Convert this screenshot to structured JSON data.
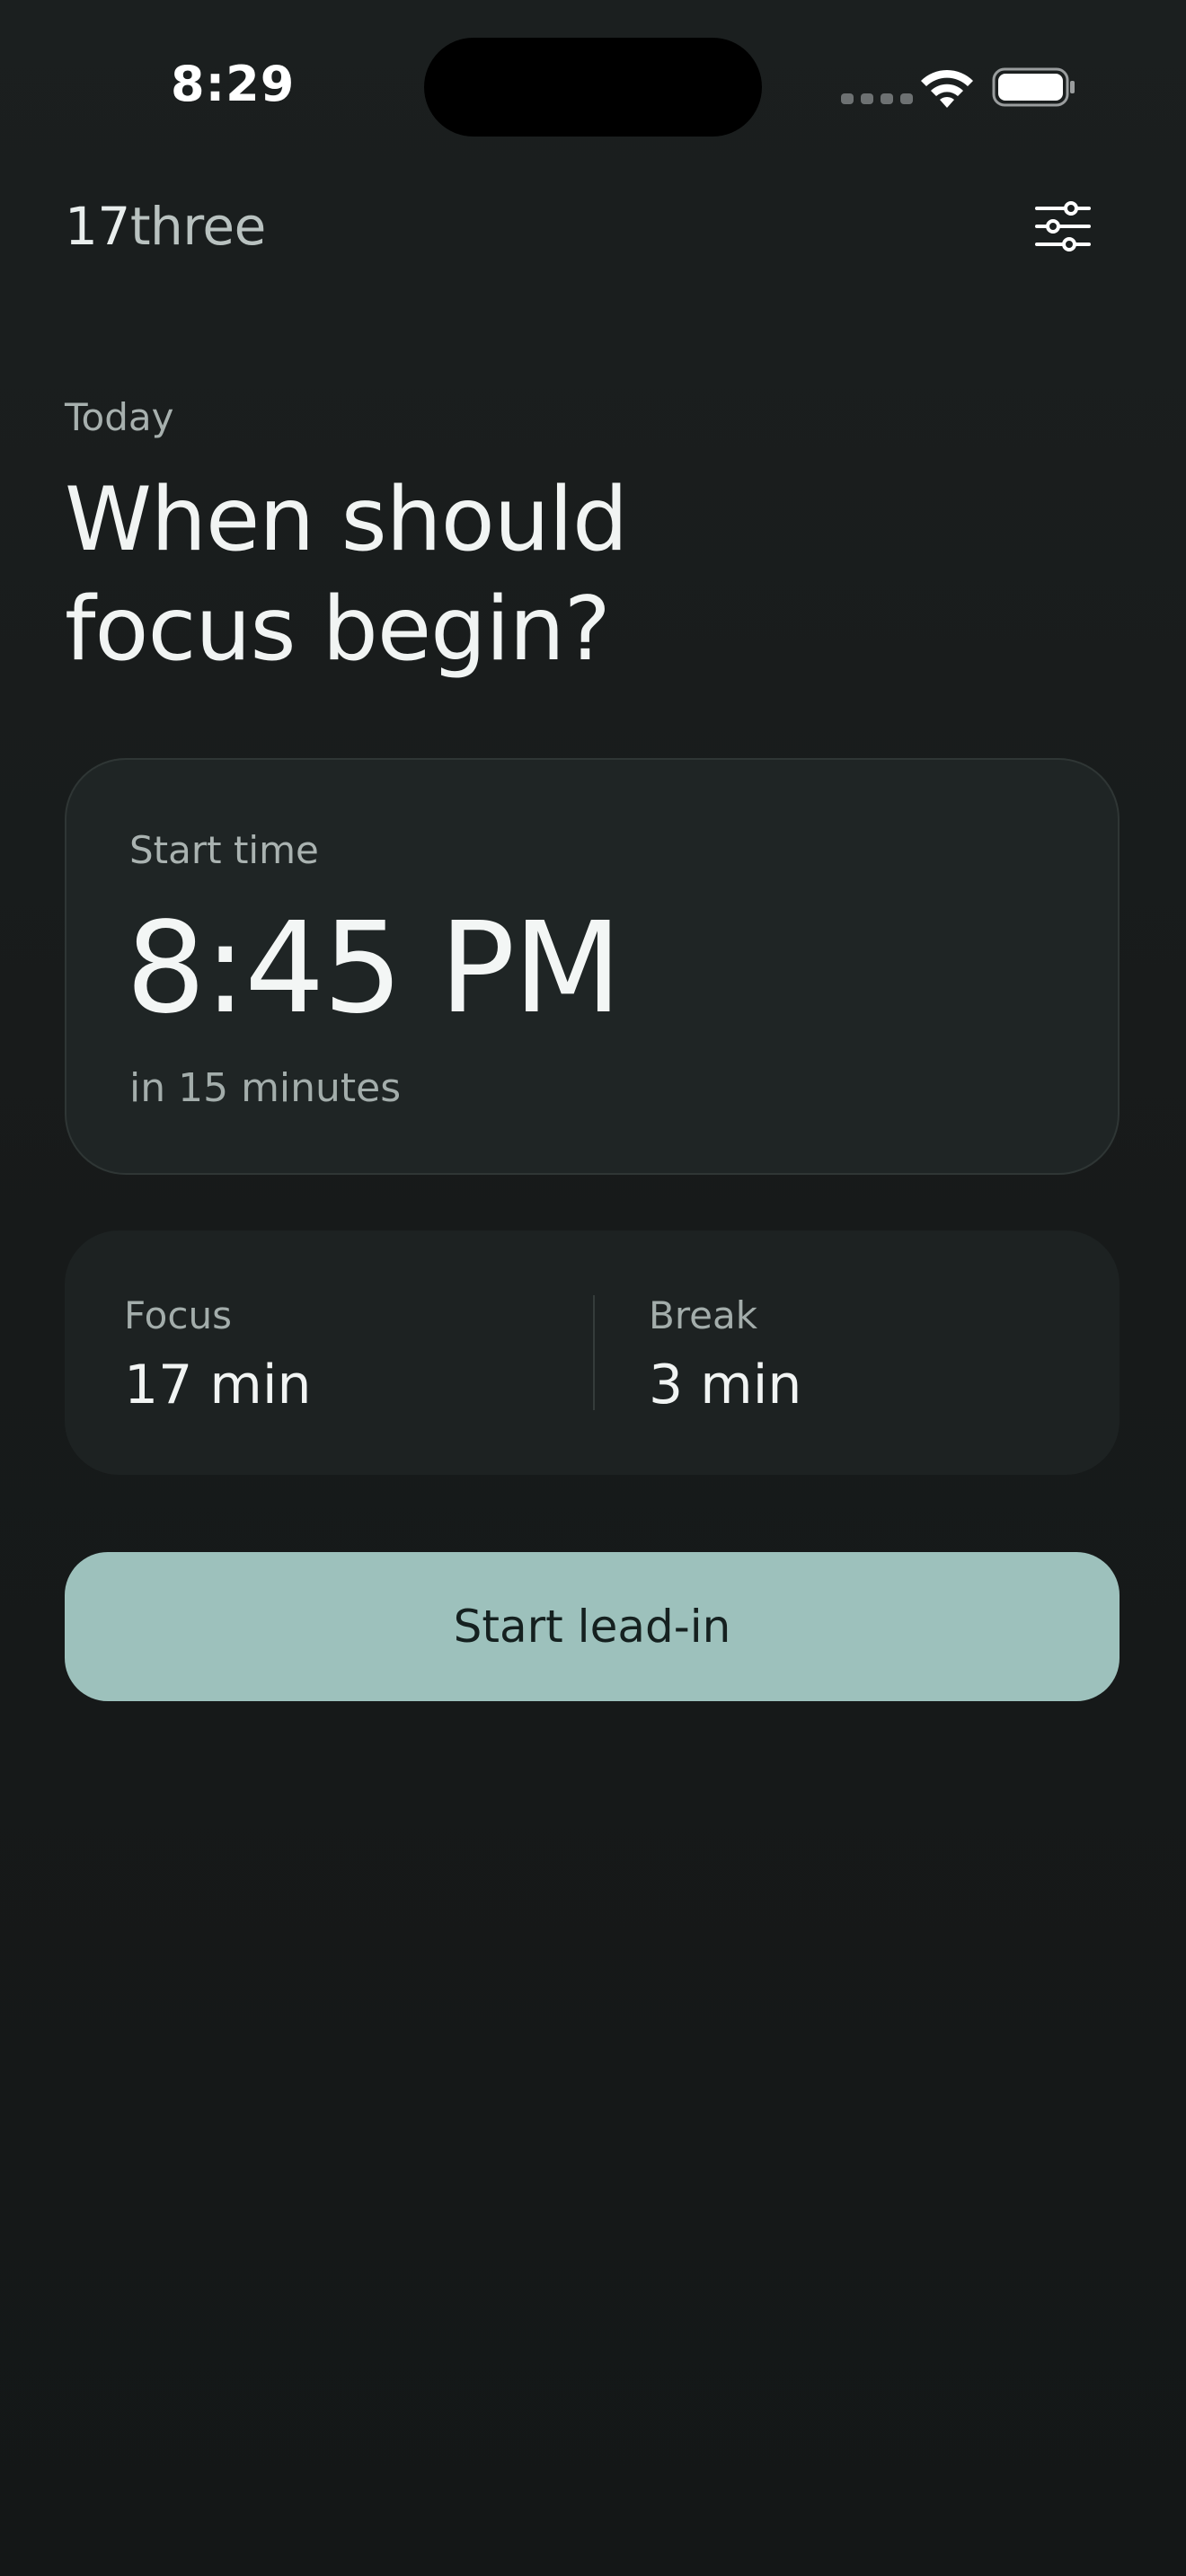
{
  "status_bar": {
    "time": "8:29",
    "signal_icon": "cellular-signal-icon",
    "wifi_icon": "wifi-icon",
    "battery_icon": "battery-icon"
  },
  "header": {
    "brand_part1": "17",
    "brand_part2": "three",
    "settings_icon": "sliders-icon"
  },
  "title": {
    "eyebrow": "Today",
    "line1": "When should",
    "line2": "focus begin?"
  },
  "start_card": {
    "label": "Start time",
    "time": "8:45 PM",
    "relative": "in 15 minutes"
  },
  "intervals": {
    "focus_label": "Focus",
    "focus_value": "17 min",
    "break_label": "Break",
    "break_value": "3 min"
  },
  "cta": {
    "label": "Start lead-in"
  },
  "colors": {
    "background": "#171a1a",
    "card": "#1f2525",
    "accent": "#9dc1bc",
    "text_primary": "#f1f4f3",
    "text_secondary": "#a3adab"
  }
}
